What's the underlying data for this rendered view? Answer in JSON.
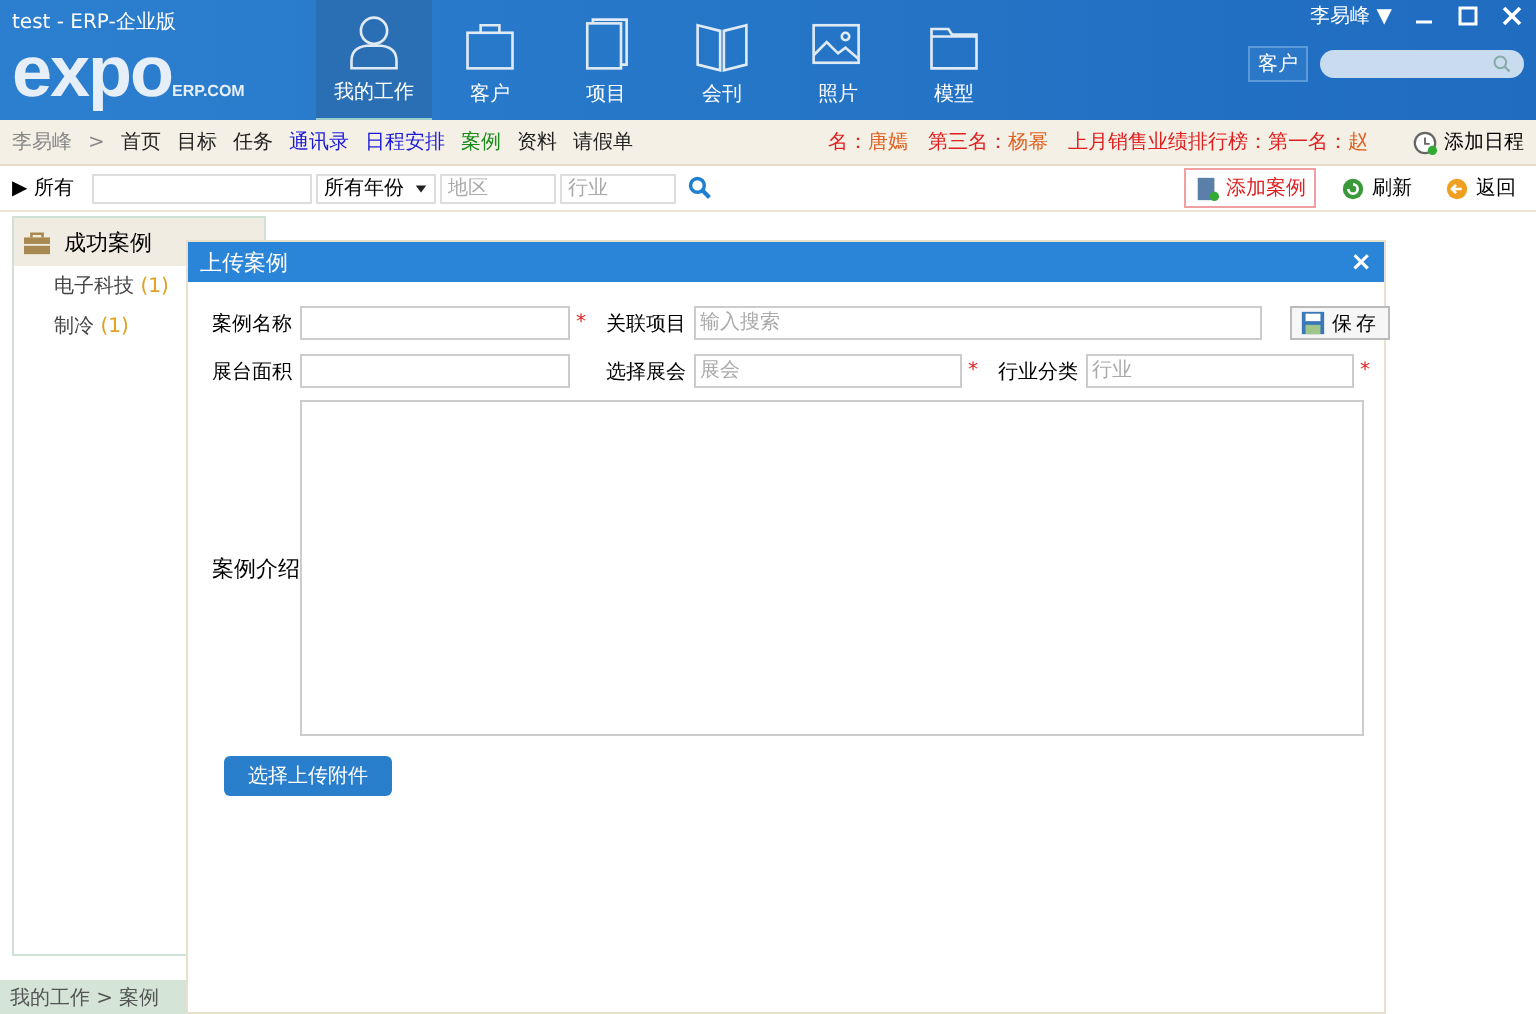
{
  "window": {
    "title": "test - ERP-企业版",
    "user": "李易峰 ▼"
  },
  "logo": {
    "main": "expo",
    "suffix": "ERP.COM"
  },
  "nav": [
    {
      "label": "我的工作",
      "kind": "person",
      "selected": true
    },
    {
      "label": "客户",
      "kind": "bag",
      "selected": false
    },
    {
      "label": "项目",
      "kind": "document",
      "selected": false
    },
    {
      "label": "会刊",
      "kind": "book",
      "selected": false
    },
    {
      "label": "照片",
      "kind": "photo",
      "selected": false
    },
    {
      "label": "模型",
      "kind": "folder",
      "selected": false
    }
  ],
  "search": {
    "scope": "客户"
  },
  "breadcrumb": {
    "user": "李易峰",
    "separator": ">",
    "links": [
      {
        "label": "首页",
        "color": "#222222"
      },
      {
        "label": "目标",
        "color": "#222222"
      },
      {
        "label": "任务",
        "color": "#222222"
      },
      {
        "label": "通讯录",
        "color": "#1a1ad8"
      },
      {
        "label": "日程安排",
        "color": "#1a1ad8"
      },
      {
        "label": "案例",
        "color": "#1a8a1a"
      },
      {
        "label": "资料",
        "color": "#222222"
      },
      {
        "label": "请假单",
        "color": "#222222"
      }
    ]
  },
  "ranking": [
    {
      "label": "名：",
      "name": "唐嫣"
    },
    {
      "label": "第三名：",
      "name": "杨幂"
    },
    {
      "label": "上月销售业绩排行榜：第一名：",
      "name": "赵"
    }
  ],
  "add_schedule": "添加日程",
  "filter": {
    "toggle": "▶ 所有",
    "year": "所有年份",
    "region_placeholder": "地区",
    "industry_placeholder": "行业"
  },
  "actions": [
    {
      "label": "添加案例",
      "kind": "add"
    },
    {
      "label": "刷新",
      "kind": "refresh"
    },
    {
      "label": "返回",
      "kind": "back"
    }
  ],
  "sidebar": {
    "title": "成功案例",
    "items": [
      {
        "label": "电子科技",
        "count": "(1)"
      },
      {
        "label": "制冷",
        "count": "(1)"
      }
    ]
  },
  "status_bar": {
    "path": "我的工作 > 案例"
  },
  "dialog": {
    "title": "上传案例",
    "close": "×",
    "fields": [
      {
        "label": "案例名称",
        "required": true
      },
      {
        "label": "关联项目",
        "placeholder": "输入搜索",
        "required": false
      },
      {
        "label": "展台面积",
        "required": false
      },
      {
        "label": "选择展会",
        "placeholder": "展会",
        "required": true
      },
      {
        "label": "行业分类",
        "placeholder": "行业",
        "required": true
      }
    ],
    "required_mark": "*",
    "save": "保存",
    "description_label": "案例介绍",
    "upload": "选择上传附件"
  }
}
